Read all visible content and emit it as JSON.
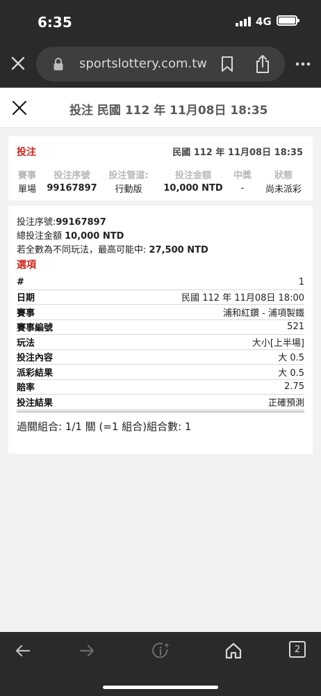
{
  "status_bar": {
    "time": "6:35",
    "network": "4G"
  },
  "browser": {
    "url": "sportslottery.com.tw"
  },
  "header": {
    "title": "投注 民國 112 年 11月08日 18:35"
  },
  "bet_card": {
    "title": "投注",
    "date": "民國 112 年 11月08日 18:35",
    "columns": [
      "賽事",
      "投注序號",
      "投注管道:",
      "投注金額",
      "中獎",
      "狀態"
    ],
    "values": [
      "單場",
      "99167897",
      "行動版",
      "10,000 NTD",
      "-",
      "尚未派彩"
    ]
  },
  "detail_card": {
    "serial_label": "投注序號:",
    "serial_value": "99167897",
    "total_label": "總投注金額 ",
    "total_value": "10,000 NTD",
    "max_label": "若全數為不同玩法，最高可能中: ",
    "max_value": "27,500 NTD",
    "options_heading": "選項",
    "rows": [
      {
        "key": "#",
        "value": "1"
      },
      {
        "key": "日期",
        "value": "民國 112 年 11月08日 18:00"
      },
      {
        "key": "賽事",
        "value": "浦和紅鑽 - 浦項製鐵"
      },
      {
        "key": "賽事編號",
        "value": "521"
      },
      {
        "key": "玩法",
        "value": "大小[上半場]"
      },
      {
        "key": "投注內容",
        "value": "大 0.5"
      },
      {
        "key": "派彩結果",
        "value": "大 0.5"
      },
      {
        "key": "賠率",
        "value": "2.75"
      },
      {
        "key": "投注結果",
        "value": "正確預測"
      }
    ],
    "combo": "過關組合: 1/1 關 (=1 組合)組合數: 1"
  },
  "toolbar": {
    "tab_count": "2"
  },
  "colors": {
    "accent_red": "#d0251c",
    "chrome_dark": "#2a2a2c"
  }
}
